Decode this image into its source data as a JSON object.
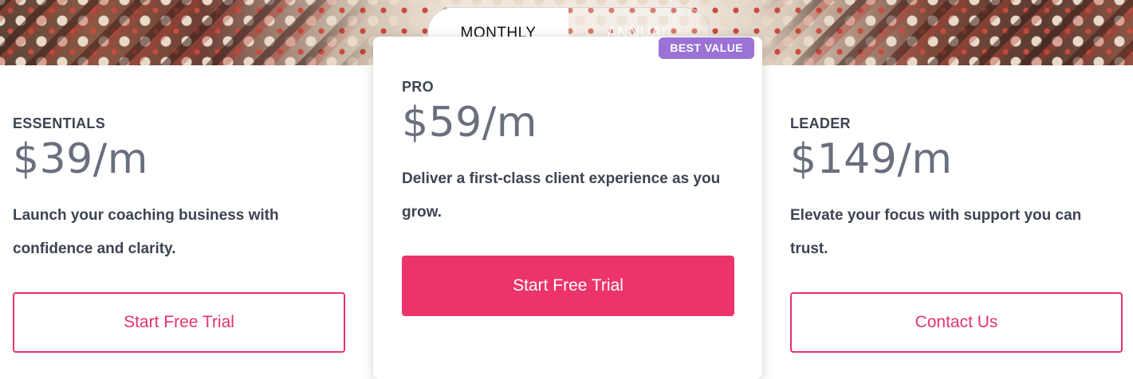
{
  "billing_toggle": {
    "options": [
      "MONTHLY",
      "ANNUAL"
    ],
    "selected": "MONTHLY"
  },
  "plans": [
    {
      "name": "ESSENTIALS",
      "price": "$39/m",
      "description": "Launch your coaching business with confidence and clarity.",
      "cta": "Start Free Trial"
    },
    {
      "name": "PRO",
      "badge": "BEST VALUE",
      "price": "$59/m",
      "description": "Deliver a first-class client experience as you grow.",
      "cta": "Start Free Trial"
    },
    {
      "name": "LEADER",
      "price": "$149/m",
      "description": "Elevate your focus with support you can trust.",
      "cta": "Contact Us"
    }
  ],
  "colors": {
    "accent": "#ec346b",
    "badge": "#9b72d6",
    "text": "#3d4451"
  }
}
